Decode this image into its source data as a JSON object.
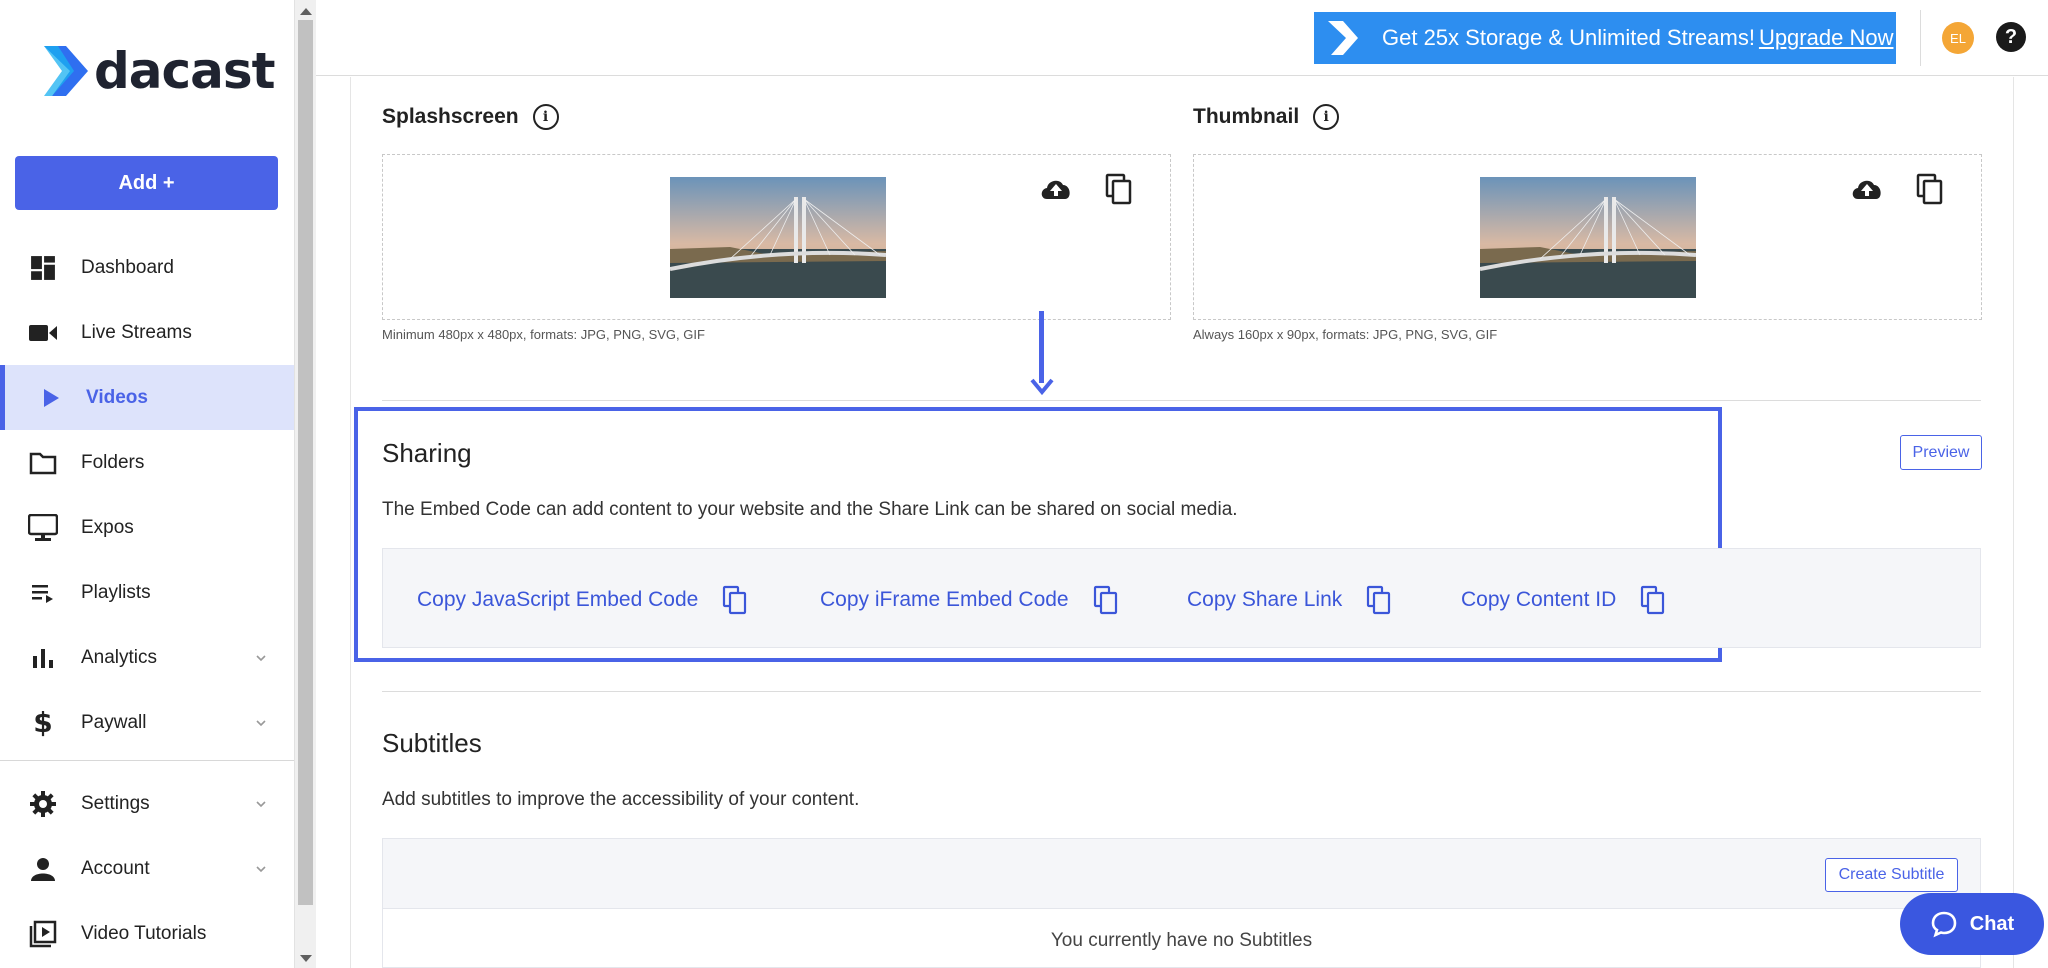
{
  "brand": {
    "name": "dacast"
  },
  "sidebar": {
    "add_label": "Add +",
    "items": [
      {
        "label": "Dashboard",
        "icon": "dashboard-icon"
      },
      {
        "label": "Live Streams",
        "icon": "video-camera-icon"
      },
      {
        "label": "Videos",
        "icon": "play-icon",
        "active": true
      },
      {
        "label": "Folders",
        "icon": "folder-icon"
      },
      {
        "label": "Expos",
        "icon": "monitor-icon"
      },
      {
        "label": "Playlists",
        "icon": "playlist-icon"
      },
      {
        "label": "Analytics",
        "icon": "bar-chart-icon",
        "expandable": true
      },
      {
        "label": "Paywall",
        "icon": "dollar-icon",
        "expandable": true
      }
    ],
    "bottom_items": [
      {
        "label": "Settings",
        "icon": "gear-icon",
        "expandable": true
      },
      {
        "label": "Account",
        "icon": "person-icon",
        "expandable": true
      },
      {
        "label": "Video Tutorials",
        "icon": "video-library-icon"
      }
    ]
  },
  "topbar": {
    "promo_text": "Get 25x Storage & Unlimited Streams!",
    "promo_link": "Upgrade Now",
    "avatar_initials": "EL",
    "help_label": "?"
  },
  "images": {
    "splashscreen": {
      "title": "Splashscreen",
      "hint": "Minimum 480px x 480px, formats: JPG, PNG, SVG, GIF"
    },
    "thumbnail": {
      "title": "Thumbnail",
      "hint": "Always 160px x 90px, formats: JPG, PNG, SVG, GIF"
    }
  },
  "sharing": {
    "title": "Sharing",
    "description": "The Embed Code can add content to your website and the Share Link can be shared on social media.",
    "preview_label": "Preview",
    "links": [
      "Copy JavaScript Embed Code",
      "Copy iFrame Embed Code",
      "Copy Share Link",
      "Copy Content ID"
    ]
  },
  "subtitles": {
    "title": "Subtitles",
    "description": "Add subtitles to improve the accessibility of your content.",
    "create_label": "Create Subtitle",
    "empty_text": "You currently have no Subtitles"
  },
  "chat": {
    "label": "Chat"
  },
  "colors": {
    "accent": "#4a63e7",
    "promo": "#2d8ef0",
    "avatar": "#f4a636"
  }
}
